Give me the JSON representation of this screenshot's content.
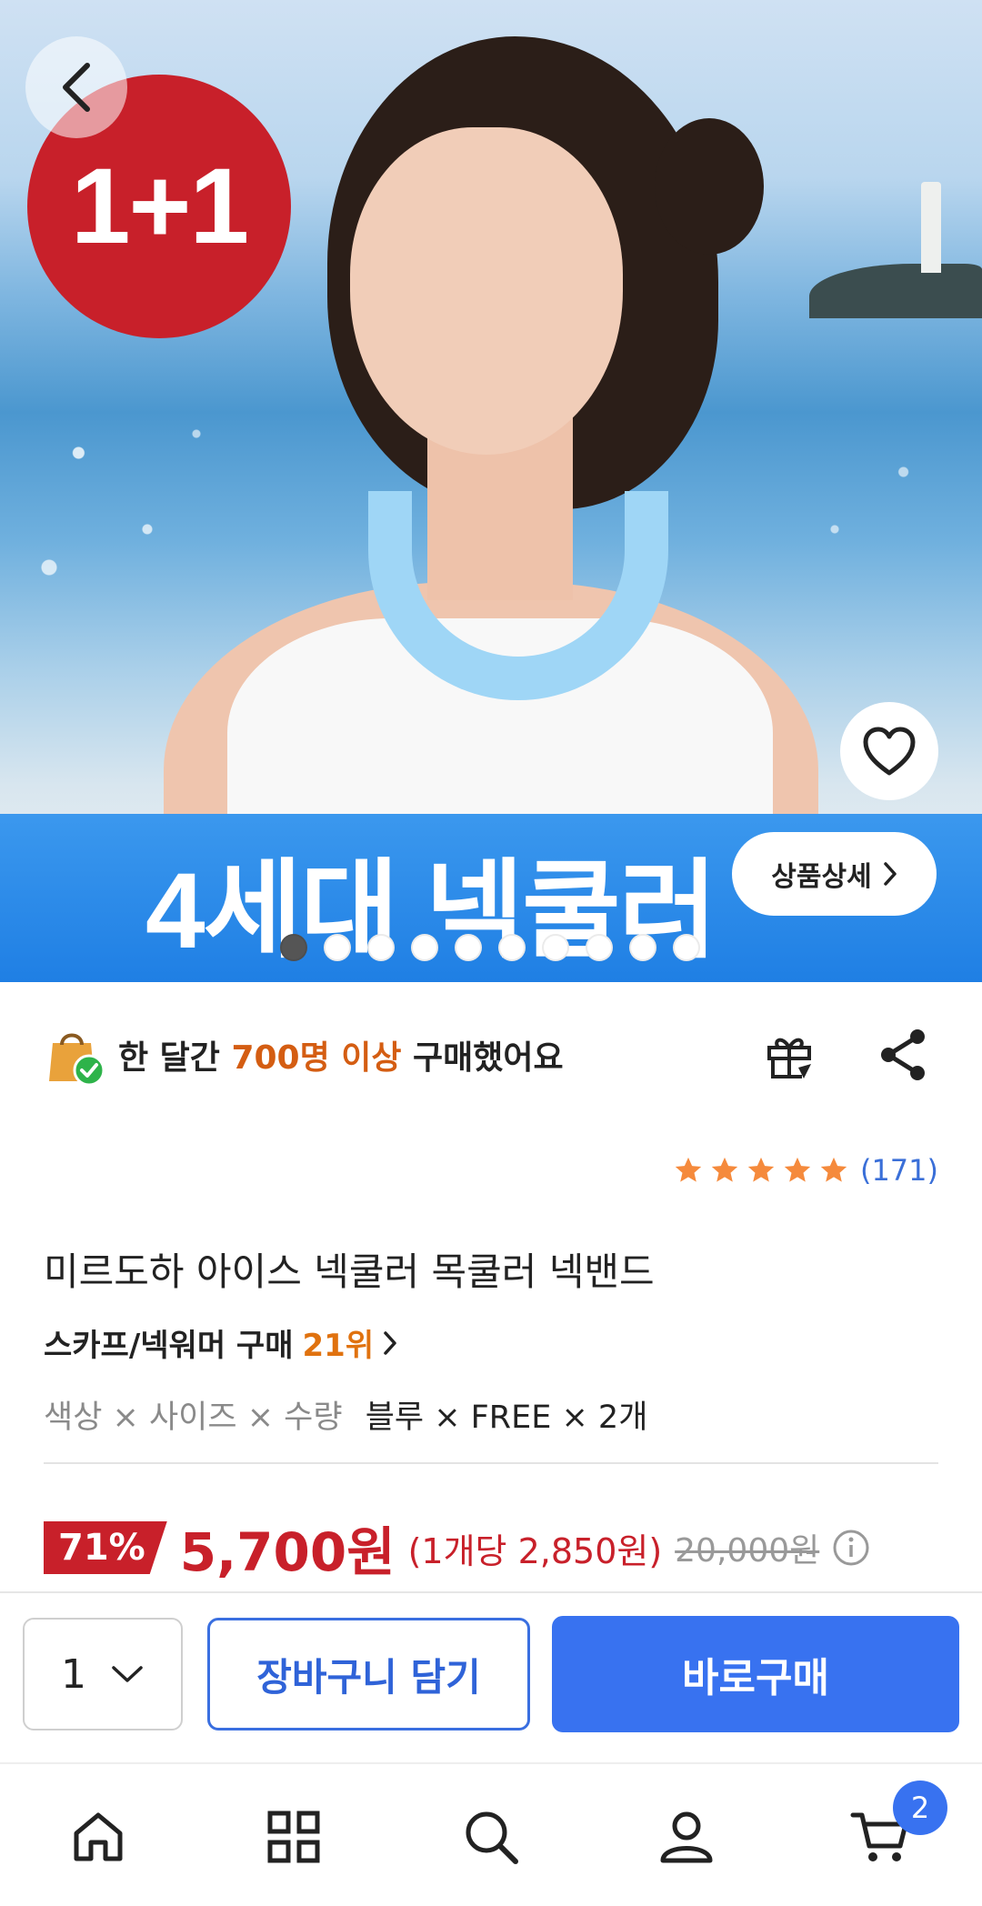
{
  "hero": {
    "promo_badge": "1+1",
    "banner_text": "4세대 넥쿨러",
    "detail_button": "상품상세",
    "slides_total": 10,
    "slide_active": 1
  },
  "purchase_info": {
    "prefix": "한 달간 ",
    "highlight": "700명 이상",
    "suffix": " 구매했어요"
  },
  "rating": {
    "stars": 5,
    "review_count": "(171)"
  },
  "product": {
    "title": "미르도하 아이스 넥쿨러 목쿨러 넥밴드",
    "rank_category": "스카프/넥워머 구매",
    "rank_value": "21위",
    "option_label": "색상 × 사이즈 × 수량",
    "option_value": "블루 × FREE × 2개"
  },
  "price": {
    "discount": "71%",
    "sale": "5,700원",
    "per_unit": "(1개당 2,850원)",
    "original": "20,000원"
  },
  "actions": {
    "quantity": "1",
    "add_to_cart": "장바구니 담기",
    "buy_now": "바로구매"
  },
  "nav": {
    "cart_badge": "2"
  },
  "colors": {
    "accent_blue": "#3872f0",
    "sale_red": "#c8202a",
    "highlight_orange": "#d45d12",
    "star_orange": "#f58a3c"
  }
}
